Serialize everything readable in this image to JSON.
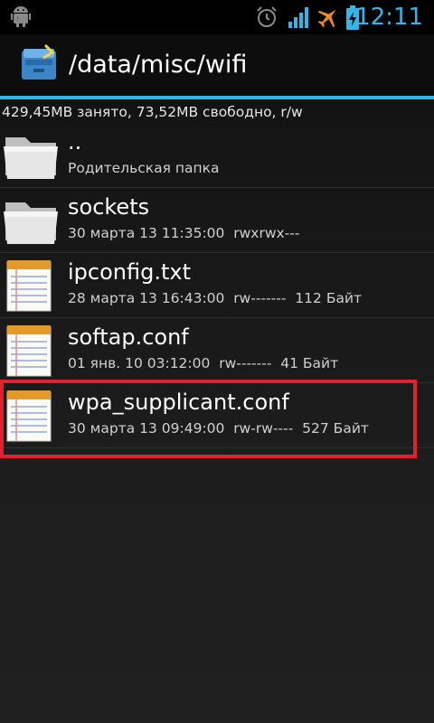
{
  "status_bar": {
    "time": "12:11",
    "icons": [
      "android-debug-icon",
      "alarm-icon",
      "signal-icon",
      "airplane-mode-icon",
      "battery-icon"
    ],
    "accent_color": "#34b5e5"
  },
  "header": {
    "title": "/data/misc/wifi",
    "app_icon": "file-manager-icon"
  },
  "storage": {
    "text": "429,45MB занято, 73,52MB свободно, r/w"
  },
  "files": [
    {
      "name": "..",
      "meta": "Родительская папка",
      "icon": "folder-icon"
    },
    {
      "name": "sockets",
      "meta": "30 марта 13 11:35:00  rwxrwx---",
      "icon": "folder-icon"
    },
    {
      "name": "ipconfig.txt",
      "meta": "28 марта 13 16:43:00  rw-------  112 Байт",
      "icon": "notepad-icon"
    },
    {
      "name": "softap.conf",
      "meta": "01 янв. 10 03:12:00  rw-------  41 Байт",
      "icon": "notepad-icon"
    },
    {
      "name": "wpa_supplicant.conf",
      "meta": "30 марта 13 09:49:00  rw-rw----  527 Байт",
      "icon": "notepad-icon"
    }
  ],
  "highlight_color": "#e3202d"
}
